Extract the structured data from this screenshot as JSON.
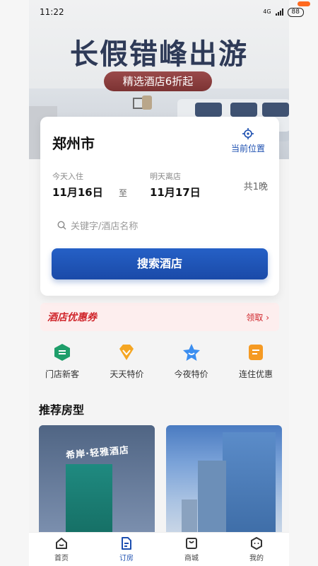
{
  "status": {
    "time": "11:22",
    "network": "4G",
    "battery": "88"
  },
  "banner": {
    "title": "长假错峰出游",
    "promo": "精选酒店6折起"
  },
  "search": {
    "city": "郑州市",
    "locate_label": "当前位置",
    "checkin_label": "今天入住",
    "checkin_date": "11月16日",
    "to": "至",
    "checkout_label": "明天离店",
    "checkout_date": "11月17日",
    "nights": "共1晚",
    "keyword_placeholder": "关键字/酒店名称",
    "button": "搜索酒店"
  },
  "coupon": {
    "title": "酒店优惠券",
    "link": "领取 ›"
  },
  "quick": [
    {
      "label": "门店新客",
      "color": "#1e9e6a"
    },
    {
      "label": "天天特价",
      "color": "#f5a623"
    },
    {
      "label": "今夜特价",
      "color": "#3b8ef0"
    },
    {
      "label": "连住优惠",
      "color": "#f59a23"
    }
  ],
  "recommend": {
    "title": "推荐房型",
    "room1_sign": "希岸·轻雅酒店"
  },
  "tabs": [
    {
      "label": "首页",
      "icon": "home-icon"
    },
    {
      "label": "订房",
      "icon": "booking-icon"
    },
    {
      "label": "商城",
      "icon": "mall-icon"
    },
    {
      "label": "我的",
      "icon": "profile-icon"
    }
  ],
  "accent": "#1c4fb0"
}
